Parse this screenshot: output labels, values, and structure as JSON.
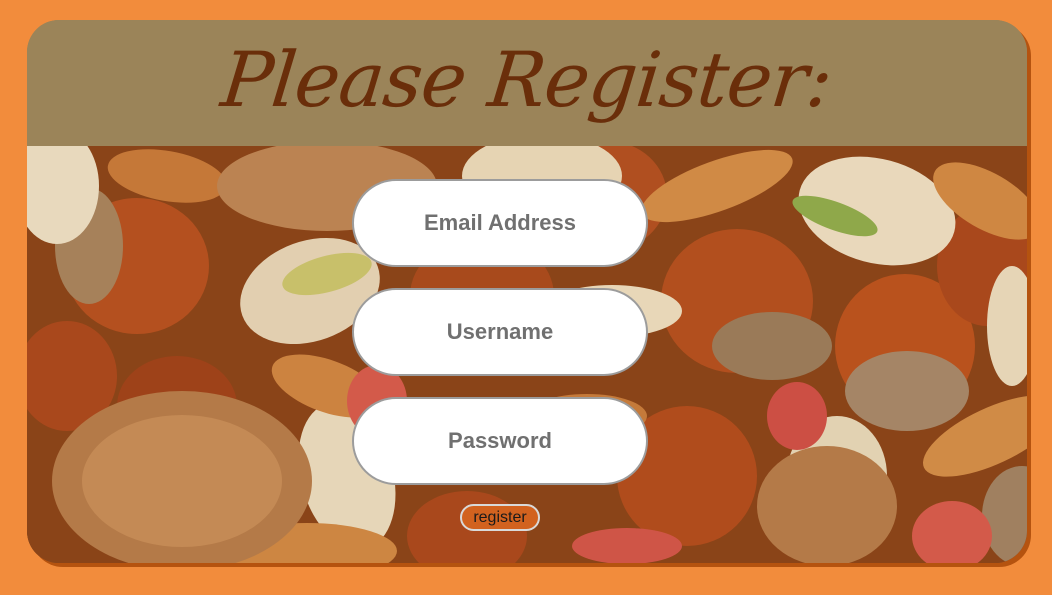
{
  "header": {
    "title": "Please Register:"
  },
  "form": {
    "email": {
      "placeholder": "Email Address",
      "value": ""
    },
    "username": {
      "placeholder": "Username",
      "value": ""
    },
    "password": {
      "placeholder": "Password",
      "value": ""
    },
    "submit_label": "register"
  },
  "background": {
    "image": "mixed-nuts-photo-icon"
  },
  "colors": {
    "page_background": "#f28c3c",
    "header_background": "#9b8459",
    "title_color": "#6a2e0a",
    "button_background": "#d2621f"
  }
}
